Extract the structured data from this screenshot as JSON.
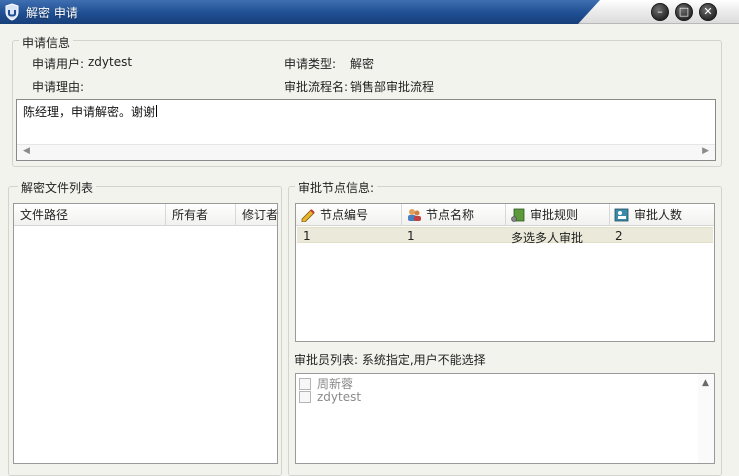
{
  "window": {
    "title": "解密 申请",
    "minimize_glyph": "–",
    "maximize_glyph": "□",
    "close_glyph": "✕",
    "accent_color": "#2a5a9e"
  },
  "request_info": {
    "group_title": "申请信息",
    "user_label": "申请用户:",
    "user_value": "zdytest",
    "type_label": "申请类型:",
    "type_value": "解密",
    "reason_label": "申请理由:",
    "flow_label": "审批流程名:",
    "flow_value": "销售部审批流程",
    "reason_text": "陈经理，申请解密。谢谢"
  },
  "file_list": {
    "group_title": "解密文件列表",
    "columns": [
      "文件路径",
      "所有者",
      "修订者"
    ],
    "rows": []
  },
  "approval_nodes": {
    "group_title": "审批节点信息:",
    "columns": [
      {
        "label": "节点编号",
        "icon": "pencil-icon"
      },
      {
        "label": "节点名称",
        "icon": "users-icon"
      },
      {
        "label": "审批规则",
        "icon": "rule-book-icon"
      },
      {
        "label": "审批人数",
        "icon": "people-count-icon"
      }
    ],
    "rows": [
      {
        "id": "1",
        "name": "1",
        "rule": "多选多人审批",
        "count": "2"
      }
    ],
    "selected_row_color": "#ebe9d9"
  },
  "approvers": {
    "label": "审批员列表: 系统指定,用户不能选择",
    "items": [
      {
        "name": "周新蓉",
        "checked": false
      },
      {
        "name": "zdytest",
        "checked": false
      }
    ]
  }
}
